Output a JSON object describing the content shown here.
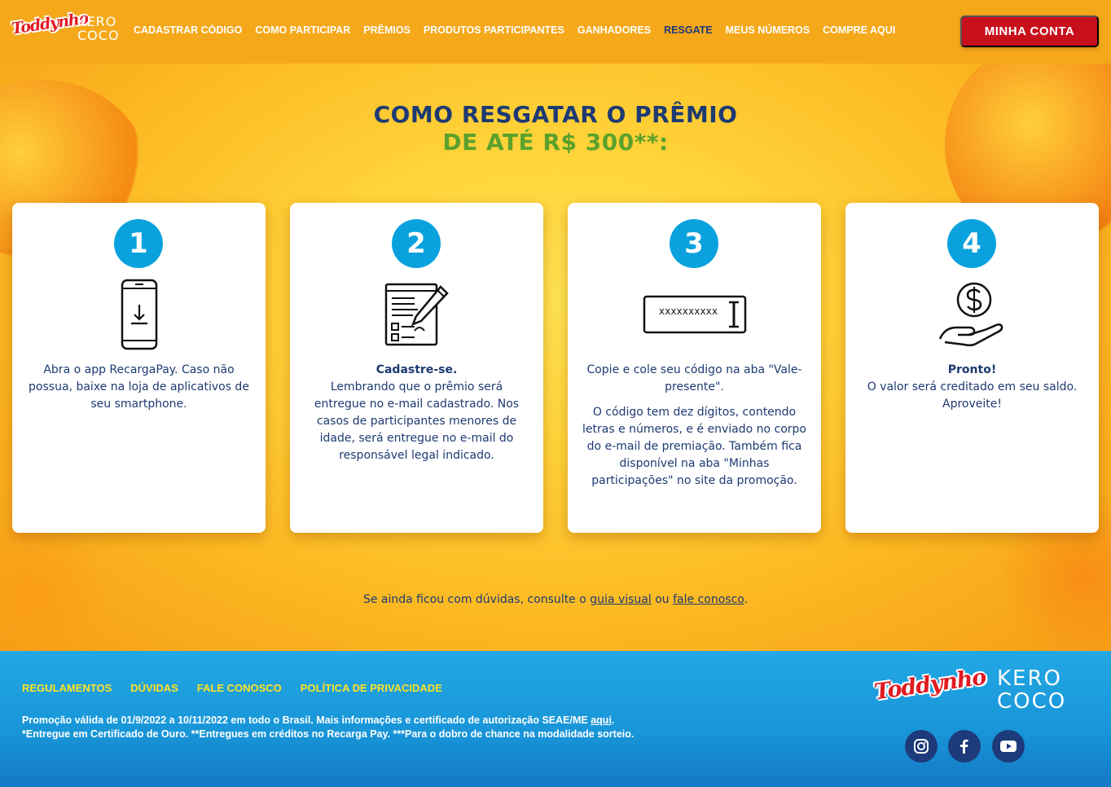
{
  "header": {
    "logo_toddynho": "Toddynho",
    "logo_kero": "KERO",
    "logo_coco": "COCO",
    "nav": [
      {
        "label": "CADASTRAR CÓDIGO"
      },
      {
        "label": "COMO PARTICIPAR"
      },
      {
        "label": "PRÊMIOS"
      },
      {
        "label": "PRODUTOS PARTICIPANTES"
      },
      {
        "label": "GANHADORES"
      },
      {
        "label": "RESGATE"
      },
      {
        "label": "MEUS NÚMEROS"
      },
      {
        "label": "COMPRE AQUI"
      }
    ],
    "active_nav": "RESGATE",
    "account_button": "MINHA CONTA"
  },
  "main": {
    "title_line1": "COMO RESGATAR O PRÊMIO",
    "title_line2": "DE ATÉ R$ 300**:",
    "steps": [
      {
        "number": "1",
        "icon": "phone-download-icon",
        "text": "Abra o app RecargaPay. Caso não possua, baixe na loja de aplicativos de seu smartphone."
      },
      {
        "number": "2",
        "icon": "form-pen-icon",
        "bold": "Cadastre-se.",
        "text": "Lembrando que o prêmio será entregue no e-mail cadastrado. Nos casos de participantes menores de idade, será entregue no e-mail do responsável legal indicado."
      },
      {
        "number": "3",
        "icon": "code-field-icon",
        "code_placeholder": "xxxxxxxxxx",
        "text": "Copie e cole seu código na aba \"Vale-presente\".",
        "text2": "O código tem dez dígitos, contendo letras e números, e é enviado no corpo do e-mail de premiação. Também fica disponível na aba \"Minhas participações\" no site da promoção."
      },
      {
        "number": "4",
        "icon": "hand-coin-icon",
        "bold": "Pronto!",
        "text": "O valor será creditado em seu saldo. Aproveite!"
      }
    ],
    "help_prefix": "Se ainda ficou com dúvidas, consulte o ",
    "help_link1": "guia visual",
    "help_mid": " ou ",
    "help_link2": "fale conosco",
    "help_suffix": "."
  },
  "footer": {
    "links": [
      {
        "label": "REGULAMENTOS"
      },
      {
        "label": "DÚVIDAS"
      },
      {
        "label": "FALE CONOSCO"
      },
      {
        "label": "POLÍTICA DE PRIVACIDADE"
      }
    ],
    "legal_line1": "Promoção válida de 01/9/2022 a 10/11/2022 em todo o Brasil. Mais informações e certificado de autorização SEAE/ME ",
    "legal_link": "aqui",
    "legal_line1_end": ".",
    "legal_line2": "*Entregue em Certificado de Ouro. **Entregues em créditos no Recarga Pay. ***Para o dobro de chance na modalidade sorteio.",
    "logo_toddynho": "Toddynho",
    "logo_kero": "KERO",
    "logo_coco": "COCO",
    "social": [
      "instagram-icon",
      "facebook-icon",
      "youtube-icon"
    ]
  },
  "colors": {
    "header_bg": "#f5a81a",
    "nav_active": "#1d3a7a",
    "account_btn": "#c8101d",
    "title_blue": "#1d3a72",
    "title_green": "#5ba12b",
    "step_circle": "#0aa2de",
    "footer_bg": "#1895d8",
    "footer_link": "#ffe326"
  }
}
